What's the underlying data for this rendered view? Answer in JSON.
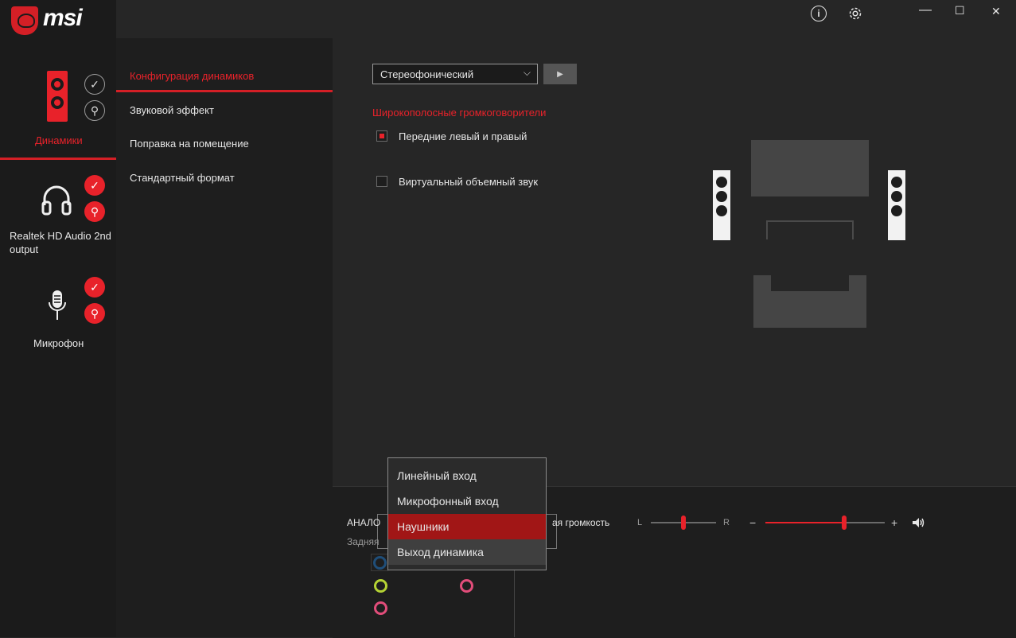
{
  "app": {
    "brand": "msi"
  },
  "window": {
    "minimize": "—",
    "maximize": "☐",
    "close": "✕"
  },
  "devices": [
    {
      "label": "Динамики"
    },
    {
      "label": "Realtek HD Audio 2nd output"
    },
    {
      "label": "Микрофон"
    }
  ],
  "nav": {
    "items": [
      {
        "label": "Конфигурация динамиков"
      },
      {
        "label": "Звуковой эффект"
      },
      {
        "label": "Поправка на помещение"
      },
      {
        "label": "Стандартный формат"
      }
    ]
  },
  "config": {
    "select_value": "Стереофонический",
    "fullrange_title": "Широкополосные громкоговорители",
    "front_lr": {
      "label": "Передние левый и правый",
      "checked": true
    },
    "virtual_surround": {
      "label": "Виртуальный объемный звук",
      "checked": false
    }
  },
  "bottom": {
    "analog_label": "АНАЛО",
    "rear_label": "Задняя",
    "volume_label": "ая громкость",
    "balance_left": "L",
    "balance_right": "R",
    "volume_minus": "−",
    "volume_plus": "+",
    "balance_value": 0.5,
    "volume_value": 0.66
  },
  "jack_colors": {
    "blue": "#1f4e79",
    "green": "#b5d334",
    "pink": "#e24d7a"
  },
  "dropdown": {
    "items": [
      {
        "label": "Линейный вход"
      },
      {
        "label": "Микрофонный вход"
      },
      {
        "label": "Наушники"
      },
      {
        "label": "Выход динамика"
      }
    ]
  }
}
